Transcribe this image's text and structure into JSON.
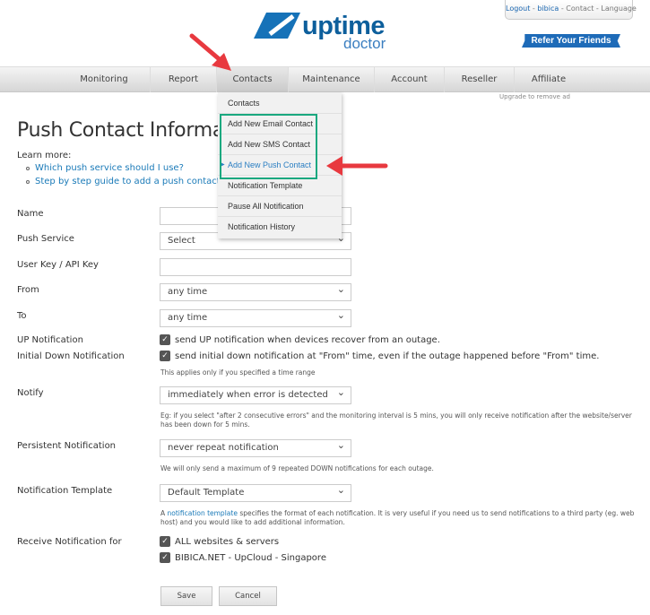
{
  "header": {
    "top_links": {
      "logout": "Logout",
      "sep1": " - ",
      "user": "bibica",
      "sep2": " - ",
      "contact": "Contact",
      "sep3": " - ",
      "language": "Language"
    },
    "refer_button": "Refer Your Friends",
    "logo_word1": "uptime",
    "logo_word2": "doctor",
    "brand_color": "#0d5f9c"
  },
  "nav": {
    "items": [
      "Monitoring",
      "Report",
      "Contacts",
      "Maintenance",
      "Account",
      "Reseller",
      "Affiliate"
    ],
    "active": "Contacts",
    "upgrade_note": "Upgrade to remove ad"
  },
  "dropdown": {
    "items": [
      "Contacts",
      "Add New Email Contact",
      "Add New SMS Contact",
      "Add New Push Contact",
      "Notification Template",
      "Pause All Notification",
      "Notification History"
    ],
    "highlighted": "Add New Push Contact",
    "highlight_color": "#19a87f",
    "arrow_color": "#e8393f"
  },
  "page": {
    "title": "Push Contact Informat",
    "learn_more": "Learn more:",
    "links": [
      "Which push service should I use?",
      "Step by step guide to add a push contact"
    ]
  },
  "form": {
    "name_label": "Name",
    "name_value": "",
    "push_service_label": "Push Service",
    "push_service_value": "Select",
    "user_key_label": "User Key / API Key",
    "user_key_value": "",
    "from_label": "From",
    "from_value": "any time",
    "to_label": "To",
    "to_value": "any time",
    "up_label": "UP Notification",
    "up_check": "send UP notification when devices recover from an outage.",
    "init_label": "Initial Down Notification",
    "init_check": "send initial down notification at \"From\" time, even if the outage happened before \"From\" time.",
    "init_hint": "This applies only if you specified a time range",
    "notify_label": "Notify",
    "notify_value": "immediately when error is detected",
    "notify_hint": "Eg: if you select \"after 2 consecutive errors\" and the monitoring interval is 5 mins, you will only receive notification after the website/server has been down for 5 mins.",
    "persist_label": "Persistent Notification",
    "persist_value": "never repeat notification",
    "persist_hint": "We will only send a maximum of 9 repeated DOWN notifications for each outage.",
    "template_label": "Notification Template",
    "template_value": "Default Template",
    "template_hint_pre": "A ",
    "template_hint_link": "notification template",
    "template_hint_post": " specifies the format of each notification. It is very useful if you need us to send notifications to a third party (eg. web host) and you would like to add additional information.",
    "receive_label": "Receive Notification for",
    "receive_items": [
      "ALL websites & servers",
      "BIBICA.NET - UpCloud - Singapore"
    ],
    "save": "Save",
    "cancel": "Cancel"
  }
}
